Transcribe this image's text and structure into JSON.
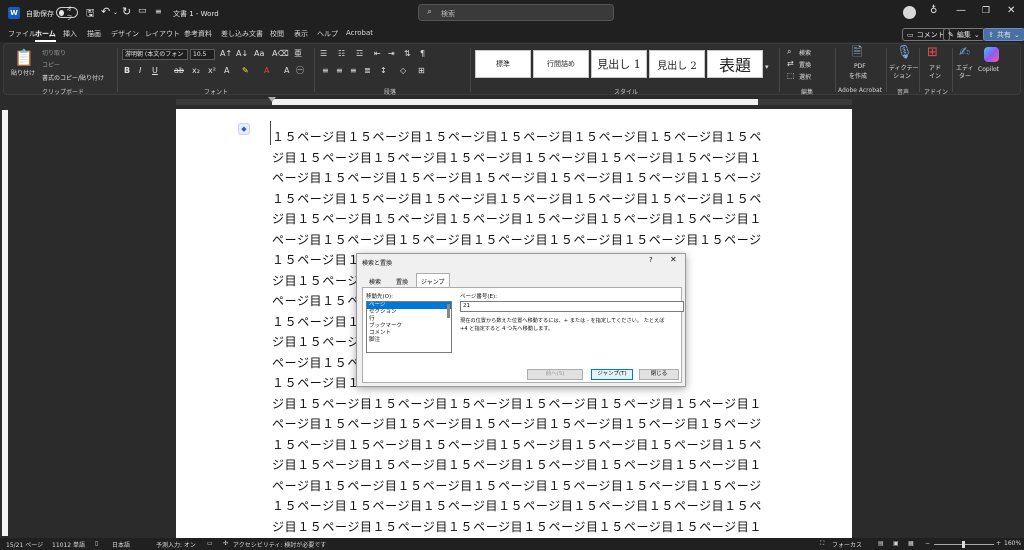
{
  "titlebar": {
    "autosave_label": "自動保存",
    "autosave_state": "オフ",
    "doc_title": "文書 1  -  Word",
    "search_placeholder": "検索"
  },
  "tabs": [
    "ファイル",
    "ホーム",
    "挿入",
    "描画",
    "デザイン",
    "レイアウト",
    "参考資料",
    "差し込み文書",
    "校閲",
    "表示",
    "ヘルプ",
    "Acrobat"
  ],
  "active_tab": "ホーム",
  "top_buttons": {
    "comment": "コメント",
    "edit": "編集",
    "share": "共有"
  },
  "ribbon": {
    "clipboard": {
      "paste": "貼り付け",
      "cut": "切り取り",
      "copy": "コピー",
      "format_painter": "書式のコピー/貼り付け",
      "group": "クリップボード"
    },
    "font": {
      "name": "游明朝 (本文のフォン",
      "size": "10.5",
      "group": "フォント"
    },
    "paragraph": {
      "group": "段落"
    },
    "styles": {
      "items": [
        "標準",
        "行間詰め",
        "見出し 1",
        "見出し 2",
        "表題"
      ],
      "group": "スタイル"
    },
    "editing": {
      "find": "検索",
      "replace": "置換",
      "select": "選択",
      "group": "編集"
    },
    "acrobat": {
      "pdf": "PDF",
      "create": "を作成",
      "group": "Adobe Acrobat"
    },
    "voice": {
      "dictate": "ディクテー",
      "dictate2": "ション",
      "group": "音声"
    },
    "addins": {
      "label": "アド",
      "label2": "イン",
      "group": "アドイン"
    },
    "editor": {
      "label": "エディ",
      "label2": "ター"
    },
    "copilot": {
      "label": "Copilot"
    }
  },
  "document": {
    "lines": [
      "１５ページ目１５ページ目１５ページ目１５ページ目１５ページ目１５ページ目１５ペー",
      "ジ目１５ページ目１５ページ目１５ページ目１５ページ目１５ページ目１５ページ目１５",
      "ページ目１５ページ目１５ページ目１５ページ目１５ページ目１５ページ目１５ページ目",
      "１５ページ目１５ページ目１５ページ目１５ページ目１５ページ目１５ページ目１５ペー",
      "ジ目１５ページ目１５ページ目１５ページ目１５ページ目１５ページ目１５ページ目１５",
      "ページ目１５ページ目１５ページ目１５ページ目１５ページ目１５ページ目１５ページ目",
      "１５ページ目１５",
      "ジ目１５ページ目",
      "ページ目１５ペー",
      "１５ページ目１５",
      "ジ目１５ページ目",
      "ページ目１５ペー",
      "１５ページ目１５",
      "ジ目１５ページ目１５ページ目１５ページ目１５ページ目１５ページ目１５ページ目１５",
      "ページ目１５ページ目１５ページ目１５ページ目１５ページ目１５ページ目１５ページ目",
      "１５ページ目１５ページ目１５ページ目１５ページ目１５ページ目１５ページ目１５ペー",
      "ジ目１５ページ目１５ページ目１５ページ目１５ページ目１５ページ目１５ページ目１５",
      "ページ目１５ページ目１５ページ目１５ページ目１５ページ目１５ページ目１５ページ目",
      "１５ページ目１５ページ目１５ページ目１５ページ目１５ページ目１５ページ目１５ペー",
      "ジ目１５ページ目１５ページ目１５ページ目１５ページ目１５ページ目１５ページ目１５"
    ]
  },
  "dialog": {
    "title": "検索と置換",
    "help": "?",
    "tabs": [
      "検索",
      "置換",
      "ジャンプ"
    ],
    "active_tab": "ジャンプ",
    "goto_what_label": "移動先(O):",
    "goto_items": [
      "ページ",
      "セクション",
      "行",
      "ブックマーク",
      "コメント",
      "脚注"
    ],
    "selected_item": "ページ",
    "page_number_label": "ページ番号(E):",
    "page_number_value": "21",
    "hint_line1": "現在の位置から数えた位置へ移動するには、+ または - を指定してください。 たとえば",
    "hint_line2": "+4 と指定すると 4 つ先へ移動します。",
    "buttons": {
      "previous": "前へ(S)",
      "goto": "ジャンプ(T)",
      "close": "閉じる"
    }
  },
  "statusbar": {
    "page": "15/21 ページ",
    "words": "11012 単語",
    "language": "日本語",
    "predictive": "予測入力: オン",
    "accessibility": "アクセシビリティ: 検討が必要です",
    "focus": "フォーカス",
    "zoom": "160%"
  },
  "colors": {
    "selection": "#0078d7",
    "background": "#2b2b2b"
  }
}
